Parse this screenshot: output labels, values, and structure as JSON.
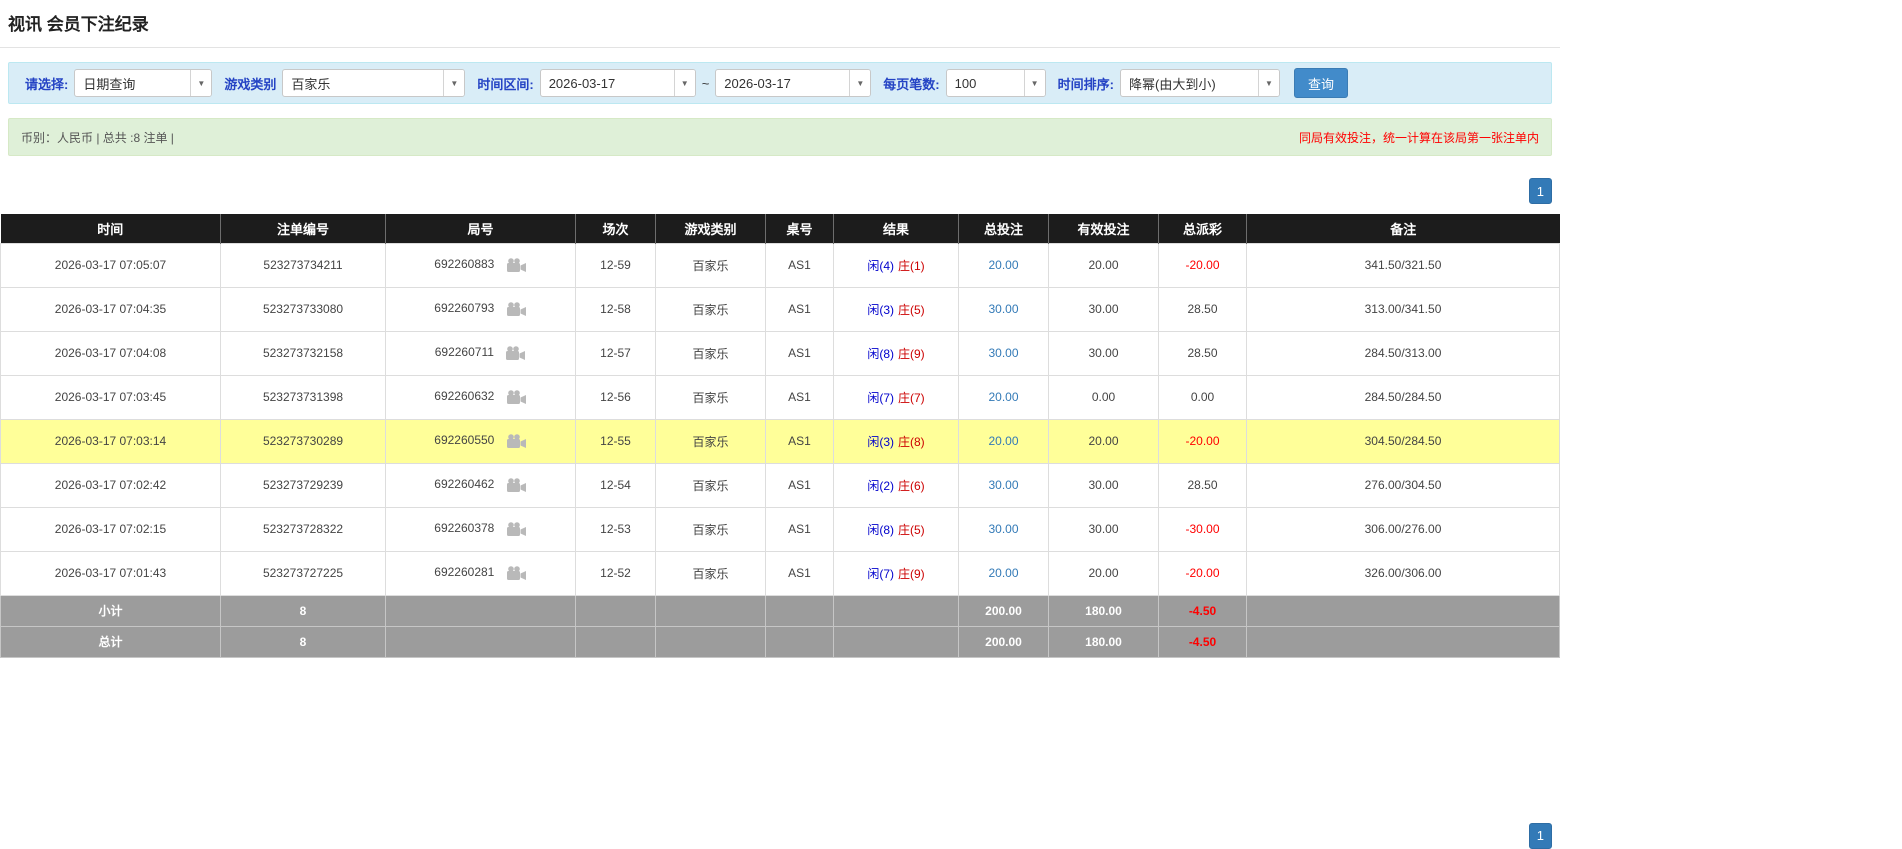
{
  "page": {
    "title": "视讯 会员下注纪录"
  },
  "filter_bar": {
    "query_type": {
      "label": "请选择:",
      "value": "日期查询"
    },
    "game_type": {
      "label": "游戏类别",
      "value": "百家乐"
    },
    "time_range": {
      "label": "时间区间:",
      "from": "2026-03-17",
      "separator": "~",
      "to": "2026-03-17"
    },
    "page_size": {
      "label": "每页笔数:",
      "value": "100"
    },
    "sort": {
      "label": "时间排序:",
      "value": "降幂(由大到小)"
    },
    "search_button": "查询"
  },
  "summary_bar": {
    "currency_info": "币别：人民币 | 总共 :8 注单 |",
    "notice": "同局有效投注，统一计算在该局第一张注单内"
  },
  "pagination": {
    "current_page": "1"
  },
  "icons": {
    "dropdown_caret": "▼",
    "round_replay": "video-camera"
  },
  "colors": {
    "accent": "#428bca",
    "filter_bg": "#d9edf7",
    "summary_bg": "#dff0d8",
    "header_bg": "#1c1c1c",
    "footer_bg": "#9c9c9c",
    "highlight": "#ffff99",
    "negative": "#ff0000",
    "link": "#337ab7",
    "player_blue": "#0000cc",
    "banker_red": "#cc0000"
  },
  "table": {
    "headers": [
      "时间",
      "注单编号",
      "局号",
      "场次",
      "游戏类别",
      "桌号",
      "结果",
      "总投注",
      "有效投注",
      "总派彩",
      "备注"
    ],
    "rows": [
      {
        "time": "2026-03-17 07:05:07",
        "bet_id": "523273734211",
        "round_id": "692260883",
        "session": "12-59",
        "game_type": "百家乐",
        "table_no": "AS1",
        "result_player": "闲(4)",
        "result_banker": "庄(1)",
        "total_bet": "20.00",
        "valid_bet": "20.00",
        "payout": "-20.00",
        "note": "341.50/321.50",
        "highlight": false
      },
      {
        "time": "2026-03-17 07:04:35",
        "bet_id": "523273733080",
        "round_id": "692260793",
        "session": "12-58",
        "game_type": "百家乐",
        "table_no": "AS1",
        "result_player": "闲(3)",
        "result_banker": "庄(5)",
        "total_bet": "30.00",
        "valid_bet": "30.00",
        "payout": "28.50",
        "note": "313.00/341.50",
        "highlight": false
      },
      {
        "time": "2026-03-17 07:04:08",
        "bet_id": "523273732158",
        "round_id": "692260711",
        "session": "12-57",
        "game_type": "百家乐",
        "table_no": "AS1",
        "result_player": "闲(8)",
        "result_banker": "庄(9)",
        "total_bet": "30.00",
        "valid_bet": "30.00",
        "payout": "28.50",
        "note": "284.50/313.00",
        "highlight": false
      },
      {
        "time": "2026-03-17 07:03:45",
        "bet_id": "523273731398",
        "round_id": "692260632",
        "session": "12-56",
        "game_type": "百家乐",
        "table_no": "AS1",
        "result_player": "闲(7)",
        "result_banker": "庄(7)",
        "total_bet": "20.00",
        "valid_bet": "0.00",
        "payout": "0.00",
        "note": "284.50/284.50",
        "highlight": false
      },
      {
        "time": "2026-03-17 07:03:14",
        "bet_id": "523273730289",
        "round_id": "692260550",
        "session": "12-55",
        "game_type": "百家乐",
        "table_no": "AS1",
        "result_player": "闲(3)",
        "result_banker": "庄(8)",
        "total_bet": "20.00",
        "valid_bet": "20.00",
        "payout": "-20.00",
        "note": "304.50/284.50",
        "highlight": true
      },
      {
        "time": "2026-03-17 07:02:42",
        "bet_id": "523273729239",
        "round_id": "692260462",
        "session": "12-54",
        "game_type": "百家乐",
        "table_no": "AS1",
        "result_player": "闲(2)",
        "result_banker": "庄(6)",
        "total_bet": "30.00",
        "valid_bet": "30.00",
        "payout": "28.50",
        "note": "276.00/304.50",
        "highlight": false
      },
      {
        "time": "2026-03-17 07:02:15",
        "bet_id": "523273728322",
        "round_id": "692260378",
        "session": "12-53",
        "game_type": "百家乐",
        "table_no": "AS1",
        "result_player": "闲(8)",
        "result_banker": "庄(5)",
        "total_bet": "30.00",
        "valid_bet": "30.00",
        "payout": "-30.00",
        "note": "306.00/276.00",
        "highlight": false
      },
      {
        "time": "2026-03-17 07:01:43",
        "bet_id": "523273727225",
        "round_id": "692260281",
        "session": "12-52",
        "game_type": "百家乐",
        "table_no": "AS1",
        "result_player": "闲(7)",
        "result_banker": "庄(9)",
        "total_bet": "20.00",
        "valid_bet": "20.00",
        "payout": "-20.00",
        "note": "326.00/306.00",
        "highlight": false
      }
    ],
    "subtotal": {
      "label": "小计",
      "count": "8",
      "total_bet": "200.00",
      "valid_bet": "180.00",
      "payout": "-4.50"
    },
    "total": {
      "label": "总计",
      "count": "8",
      "total_bet": "200.00",
      "valid_bet": "180.00",
      "payout": "-4.50"
    }
  }
}
